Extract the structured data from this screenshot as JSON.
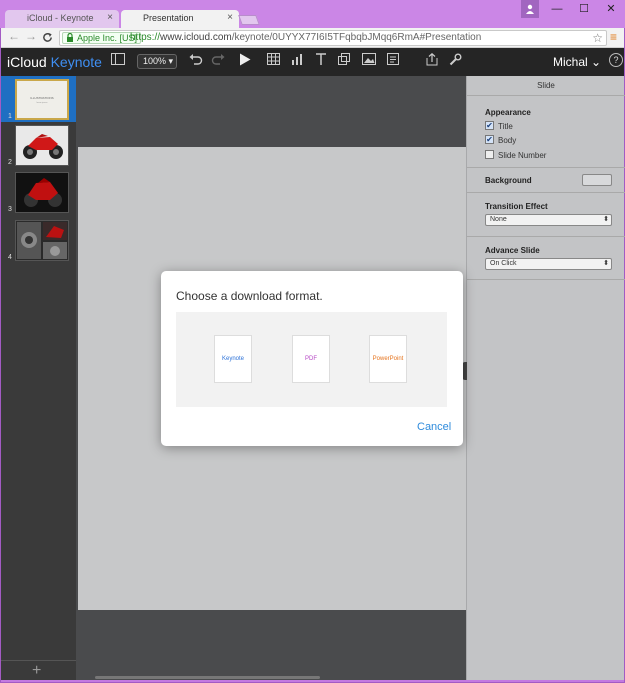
{
  "browser": {
    "tabs": [
      {
        "title": "iCloud - Keynote",
        "close": "×"
      },
      {
        "title": "Presentation",
        "close": "×"
      }
    ],
    "window_buttons": {
      "minimize": "—",
      "maximize": "☐",
      "close": "✕"
    },
    "nav": {
      "back": "←",
      "forward": "→",
      "reload": "C"
    },
    "ev_label": "Apple Inc. [US]",
    "url_scheme": "https://",
    "url_host": "www.icloud.com",
    "url_path": "/keynote/0UYYX77I6I5TFqbqbJMqq6RmA#Presentation",
    "star": "☆",
    "menu": "≡"
  },
  "app": {
    "brand_icloud": "iCloud",
    "brand_keynote": "Keynote",
    "zoom": "100%",
    "zoom_arrow": "▾",
    "user": "Michal",
    "user_arrow": "⌄",
    "help": "?"
  },
  "navigator": {
    "slides": [
      {
        "number": "1",
        "title": "ILLUSTRATIONS",
        "subtitle": "lorem ipsum"
      },
      {
        "number": "2"
      },
      {
        "number": "3"
      },
      {
        "number": "4"
      }
    ],
    "add": "+"
  },
  "inspector": {
    "header": "Slide",
    "appearance": {
      "label": "Appearance",
      "options": [
        {
          "label": "Title",
          "checked": true
        },
        {
          "label": "Body",
          "checked": true
        },
        {
          "label": "Slide Number",
          "checked": false
        }
      ]
    },
    "background_label": "Background",
    "transition": {
      "label": "Transition Effect",
      "value": "None"
    },
    "advance": {
      "label": "Advance Slide",
      "value": "On Click"
    }
  },
  "dialog": {
    "title": "Choose a download format.",
    "formats": [
      {
        "label": "Keynote",
        "color": "#2e73d8"
      },
      {
        "label": "PDF",
        "color": "#b546c4"
      },
      {
        "label": "PowerPoint",
        "color": "#e5731d"
      }
    ],
    "cancel": "Cancel"
  },
  "colors": {
    "accent": "#2e8bdc",
    "toolbar": "#252525",
    "frame": "#c47ae0"
  }
}
